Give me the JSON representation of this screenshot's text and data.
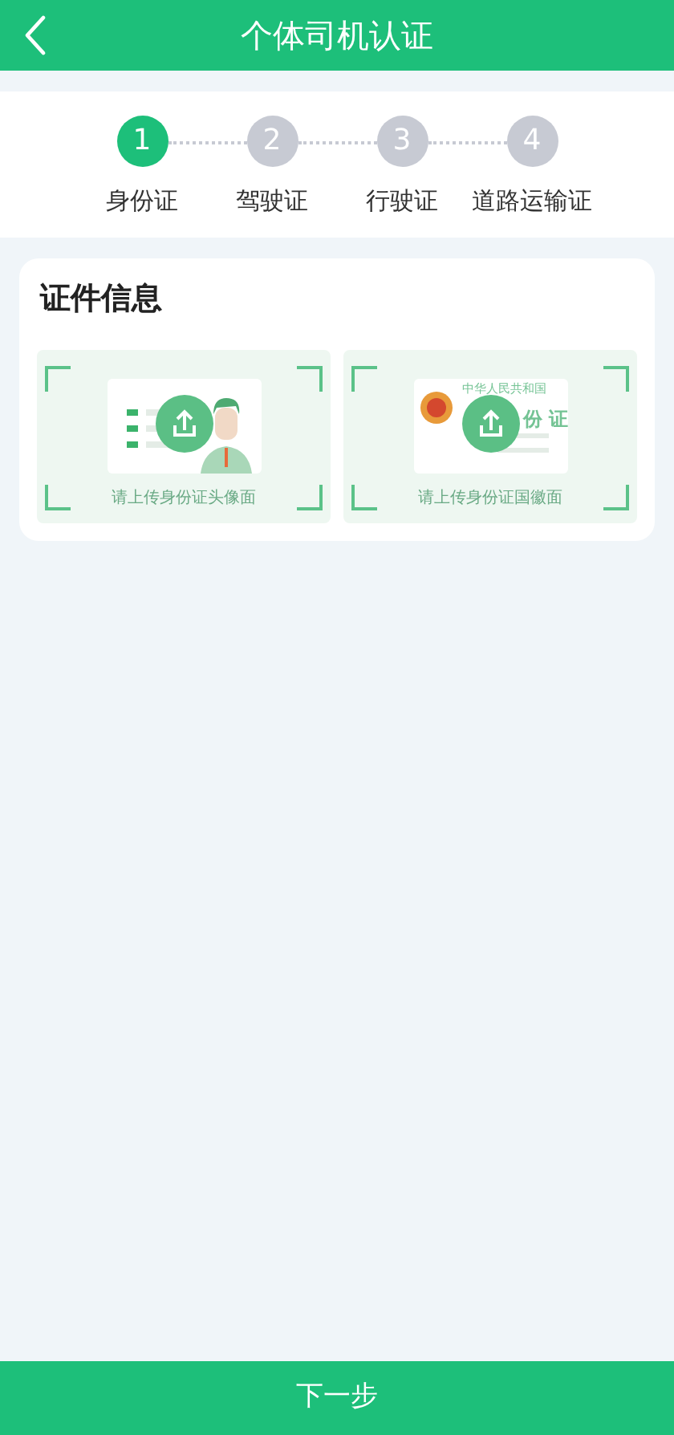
{
  "header": {
    "title": "个体司机认证"
  },
  "steps": [
    {
      "number": "1",
      "label": "身份证",
      "selected": true
    },
    {
      "number": "2",
      "label": "驾驶证",
      "selected": false
    },
    {
      "number": "3",
      "label": "行驶证",
      "selected": false
    },
    {
      "number": "4",
      "label": "道路运输证",
      "selected": false
    }
  ],
  "section": {
    "title": "证件信息"
  },
  "uploads": [
    {
      "kind": "portrait",
      "caption": "请上传身份证头像面"
    },
    {
      "kind": "emblem",
      "caption": "请上传身份证国徽面",
      "card_heading": "中华人民共和国",
      "card_text": "份 证"
    }
  ],
  "footer": {
    "button": "下一步"
  }
}
